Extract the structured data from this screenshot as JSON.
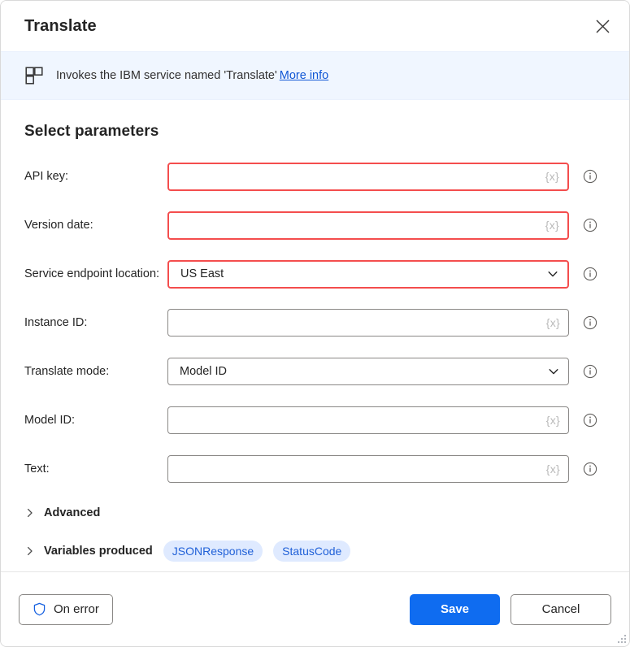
{
  "dialog": {
    "title": "Translate",
    "close_icon": "close-icon"
  },
  "banner": {
    "icon": "module-icon",
    "text": "Invokes the IBM service named 'Translate'",
    "link_label": "More info"
  },
  "main": {
    "section_title": "Select parameters",
    "fields": [
      {
        "label": "API key:",
        "type": "text",
        "value": "",
        "placeholder_token": "{x}",
        "error": true,
        "info_icon": "info-icon"
      },
      {
        "label": "Version date:",
        "type": "text",
        "value": "",
        "placeholder_token": "{x}",
        "error": true,
        "info_icon": "info-icon"
      },
      {
        "label": "Service endpoint location:",
        "type": "select",
        "value": "US East",
        "placeholder_token": "",
        "error": true,
        "info_icon": "info-icon"
      },
      {
        "label": "Instance ID:",
        "type": "text",
        "value": "",
        "placeholder_token": "{x}",
        "error": false,
        "info_icon": "info-icon"
      },
      {
        "label": "Translate mode:",
        "type": "select",
        "value": "Model ID",
        "placeholder_token": "",
        "error": false,
        "info_icon": "info-icon"
      },
      {
        "label": "Model ID:",
        "type": "text",
        "value": "",
        "placeholder_token": "{x}",
        "error": false,
        "info_icon": "info-icon"
      },
      {
        "label": "Text:",
        "type": "text",
        "value": "",
        "placeholder_token": "{x}",
        "error": false,
        "info_icon": "info-icon"
      }
    ],
    "advanced": {
      "label": "Advanced",
      "expanded": false,
      "chevron_icon": "chevron-right-icon"
    },
    "variables_produced": {
      "label": "Variables produced",
      "expanded": false,
      "chevron_icon": "chevron-right-icon",
      "pills": [
        "JSONResponse",
        "StatusCode"
      ]
    }
  },
  "footer": {
    "on_error_label": "On error",
    "on_error_icon": "shield-icon",
    "save_label": "Save",
    "cancel_label": "Cancel"
  },
  "colors": {
    "error_border": "#f44d4d",
    "primary": "#0f6cf0",
    "link": "#1157d5",
    "banner_bg": "#f0f6ff",
    "pill_bg": "#dfeaff",
    "pill_text": "#2161d8"
  }
}
